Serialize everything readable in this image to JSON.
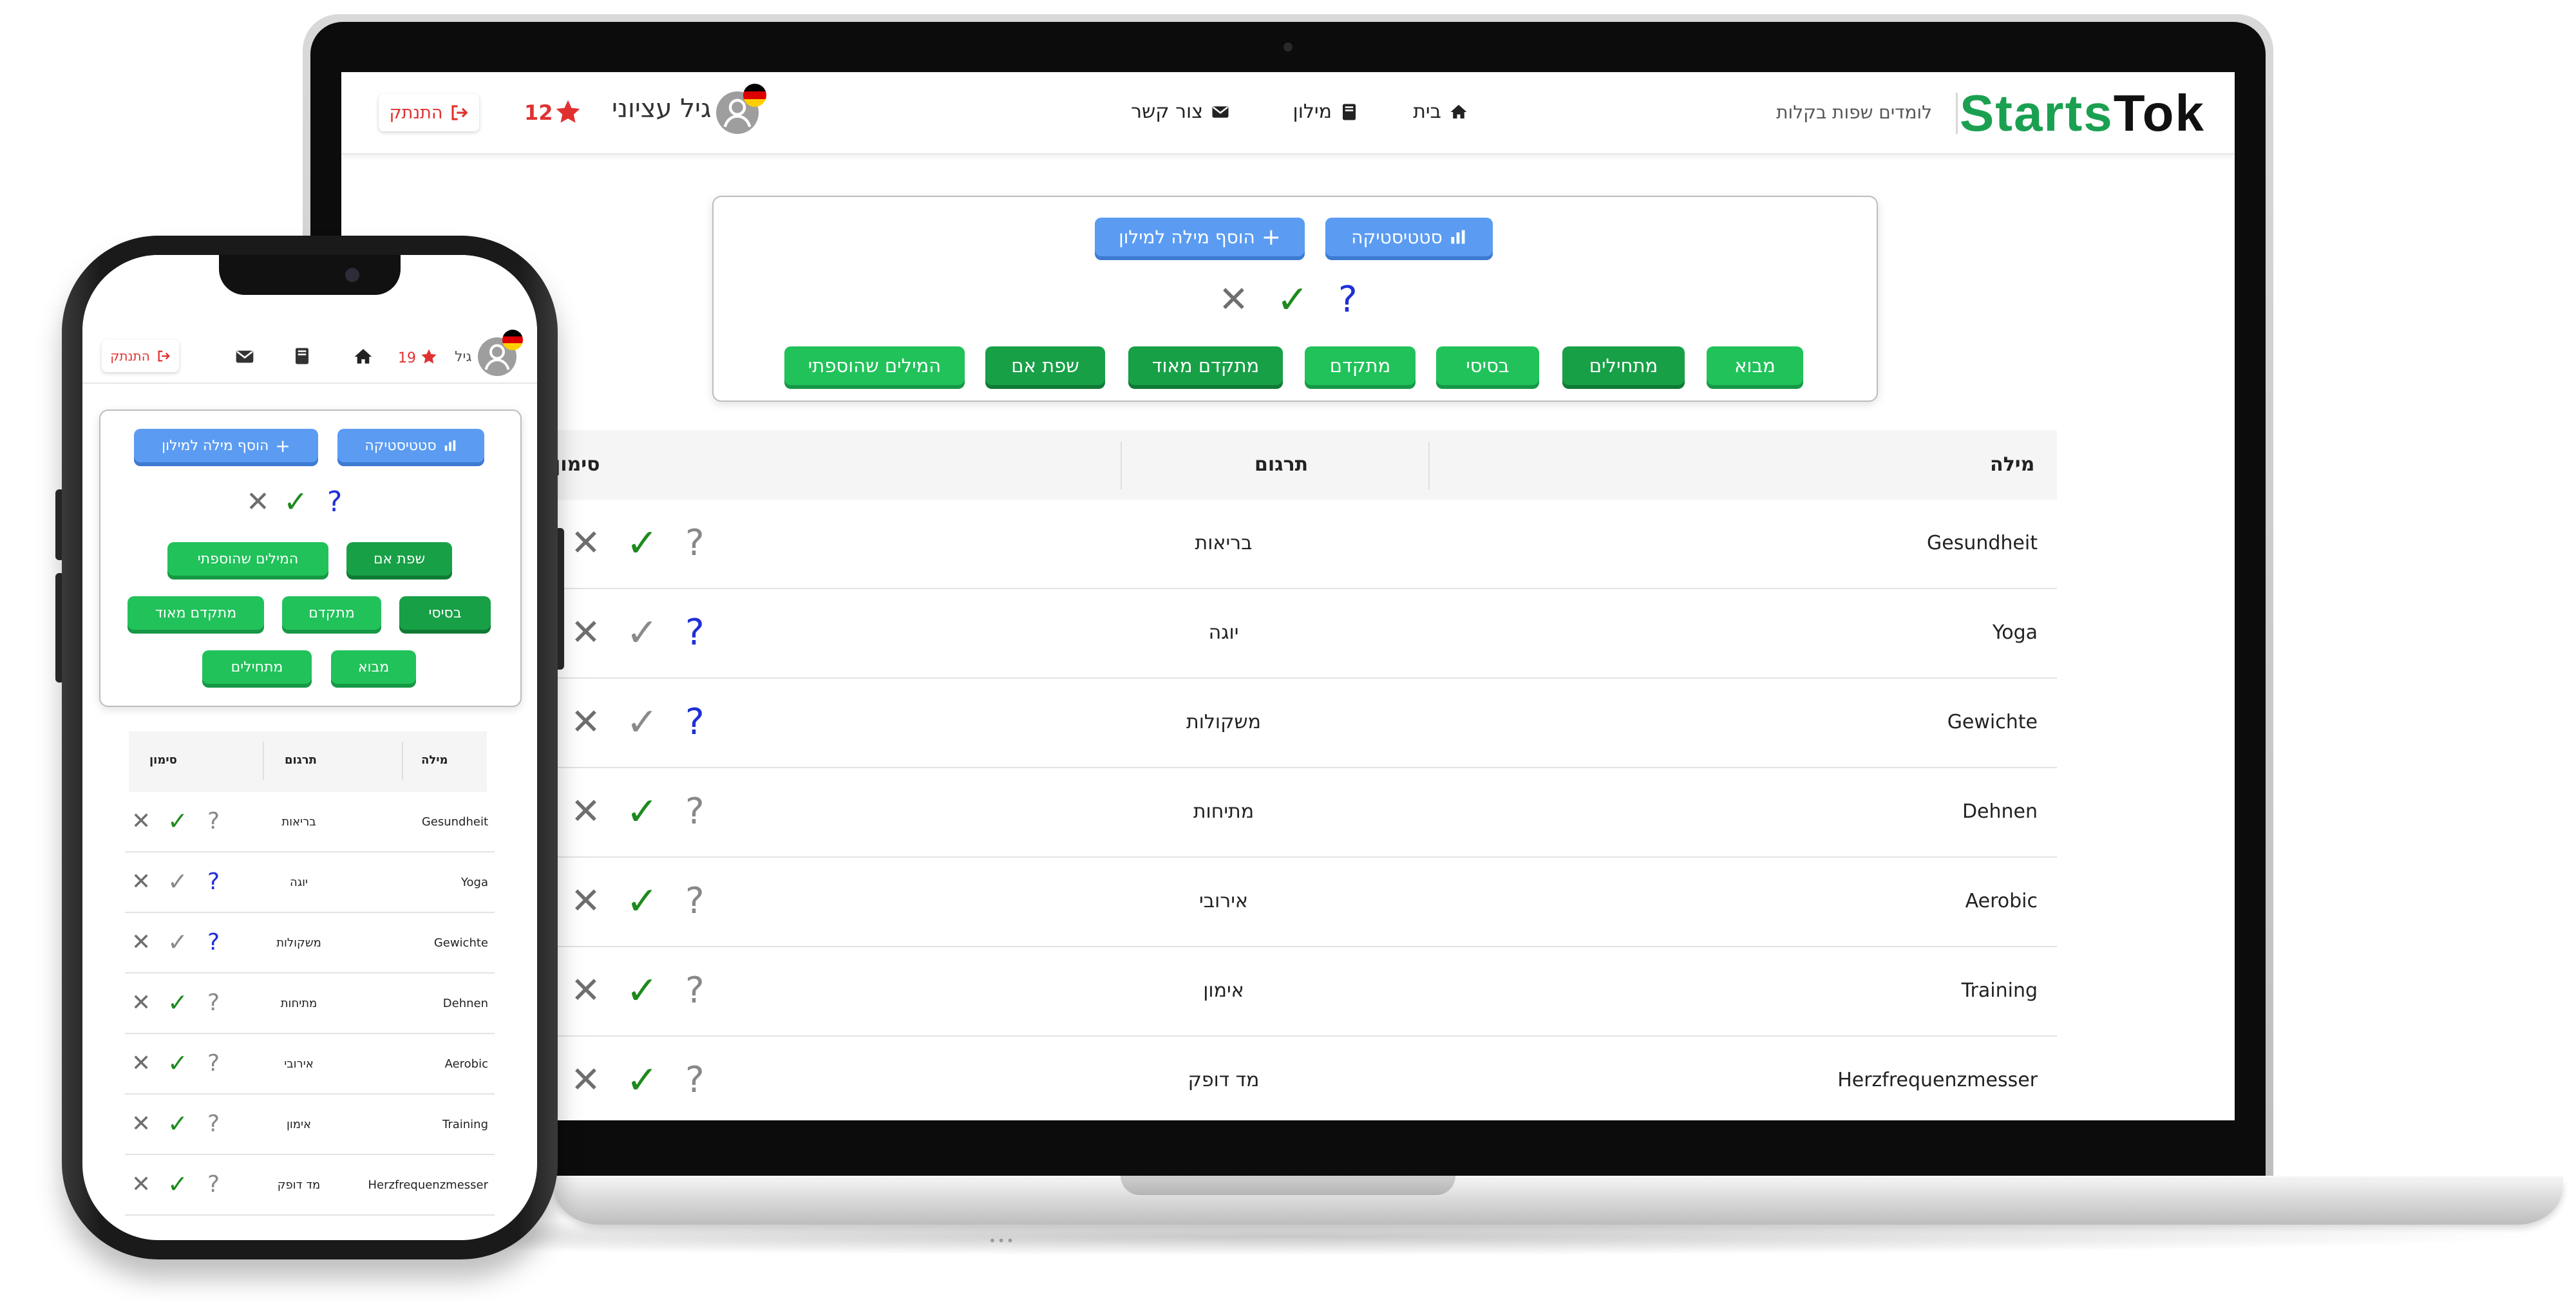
{
  "brand": {
    "part1": "Starts",
    "part2": "Tok",
    "tagline": "לומדים שפות בקלות"
  },
  "nav": {
    "home": "בית",
    "dictionary": "מילון",
    "contact": "צור קשר"
  },
  "user": {
    "name": "גיל עציוני",
    "short_name": "גיל",
    "stars_desktop": "12",
    "stars_mobile": "19",
    "logout": "התנתק"
  },
  "controls": {
    "statistics": "סטטיסטיקה",
    "add_word": "הוסף מילה למילון",
    "filter_symbols": {
      "unknown": "✕",
      "known": "✓",
      "unsure": "?"
    },
    "levels": [
      "מבוא",
      "מתחילים",
      "בסיסי",
      "מתקדם",
      "מתקדם מאוד",
      "שפת אם",
      "המילים שהוספתי"
    ]
  },
  "table": {
    "headers": {
      "word": "מילה",
      "translation": "תרגום",
      "marking": "סימון"
    },
    "rows": [
      {
        "word": "Gesundheit",
        "translation": "בריאות",
        "state": "known-question-gray"
      },
      {
        "word": "Yoga",
        "translation": "יוגה",
        "state": "unsure"
      },
      {
        "word": "Gewichte",
        "translation": "משקולות",
        "state": "unsure"
      },
      {
        "word": "Dehnen",
        "translation": "מתיחות",
        "state": "known"
      },
      {
        "word": "Aerobic",
        "translation": "אירובי",
        "state": "known"
      },
      {
        "word": "Training",
        "translation": "אימון",
        "state": "known"
      },
      {
        "word": "Herzfrequenzmesser",
        "translation": "מד דופק",
        "state": "known"
      }
    ]
  },
  "colors": {
    "brand_green": "#1aa050",
    "blue_button": "#5b9cf2",
    "green_button": "#21c25a",
    "dark_green_button": "#18a047",
    "logout_red": "#e03131"
  }
}
